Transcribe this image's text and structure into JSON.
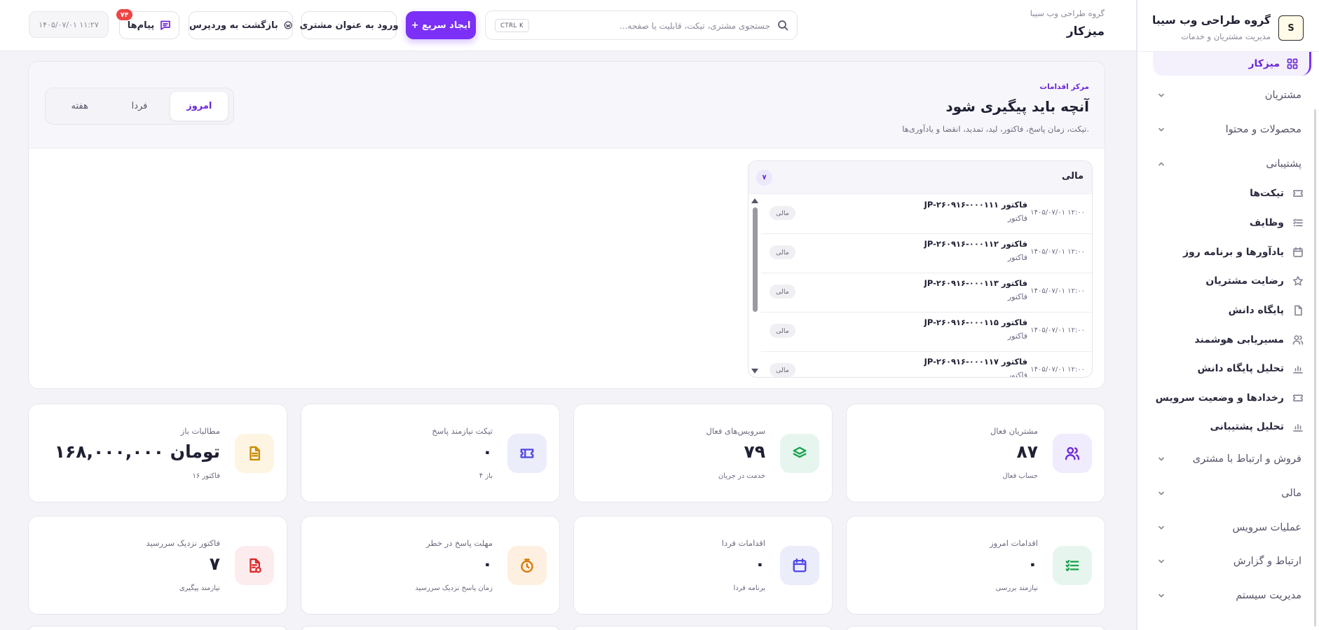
{
  "brand": {
    "logo_text": "S",
    "title": "گروه طراحی وب سیبا",
    "subtitle": "مدیریت مشتریان و خدمات"
  },
  "sidebar": {
    "active": {
      "label": "میزکار",
      "icon": "dashboard-icon"
    },
    "groups": [
      {
        "label": "مشتریان"
      },
      {
        "label": "محصولات و محتوا"
      },
      {
        "label": "پشتیبانی"
      },
      {
        "label": "فروش و ارتباط با مشتری"
      },
      {
        "label": "مالی"
      },
      {
        "label": "عملیات سرویس"
      },
      {
        "label": "ارتباط و گزارش"
      },
      {
        "label": "مدیریت سیستم"
      }
    ],
    "support_items": [
      {
        "label": "تیکت‌ها",
        "icon": "ticket-icon"
      },
      {
        "label": "وظایف",
        "icon": "task-list-icon"
      },
      {
        "label": "یادآورها و برنامه روز",
        "icon": "calendar-icon"
      },
      {
        "label": "رضایت مشتریان",
        "icon": "star-icon"
      },
      {
        "label": "پایگاه دانش",
        "icon": "document-icon"
      },
      {
        "label": "مسیریابی هوشمند",
        "icon": "users-icon"
      },
      {
        "label": "تحلیل پایگاه دانش",
        "icon": "bar-chart-icon"
      },
      {
        "label": "رخدادها و وضعیت سرویس",
        "icon": "ticket-icon"
      },
      {
        "label": "تحلیل پشتیبانی",
        "icon": "bar-chart-icon"
      }
    ]
  },
  "header": {
    "breadcrumb": "گروه طراحی وب سیبا",
    "title": "میزکار",
    "search_placeholder": "جستجوی مشتری، تیکت، قابلیت یا صفحه...",
    "search_shortcut": "CTRL K",
    "quick_create": "+ ایجاد سریع",
    "login_as_customer": "ورود به عنوان مشتری",
    "back_to_wordpress": "بازگشت به وردپرس",
    "messages": "پیام‌ها",
    "messages_count": "۷۴",
    "datetime": "۱۴۰۵/۰۷/۰۱ ۱۱:۲۷"
  },
  "action_center": {
    "kicker": "مرکز اقدامات",
    "title": "آنچه باید پیگیری شود",
    "description": "تیکت، زمان پاسخ، فاکتور، لید، تمدید، انقضا و یادآوری‌ها.",
    "tabs": [
      "امروز",
      "فردا",
      "هفته"
    ],
    "active_tab": "امروز",
    "finance_panel": {
      "title": "مالی",
      "count": "۷",
      "rows": [
        {
          "title": "فاکتور JP-۲۶۰۹۱۶-۰۰۰۱۱۱",
          "type": "فاکتور",
          "time": "۱۴۰۵/۰۷/۰۱ ۱۲:۰۰",
          "tag": "مالی"
        },
        {
          "title": "فاکتور JP-۲۶۰۹۱۶-۰۰۰۱۱۲",
          "type": "فاکتور",
          "time": "۱۴۰۵/۰۷/۰۱ ۱۲:۰۰",
          "tag": "مالی"
        },
        {
          "title": "فاکتور JP-۲۶۰۹۱۶-۰۰۰۱۱۳",
          "type": "فاکتور",
          "time": "۱۴۰۵/۰۷/۰۱ ۱۲:۰۰",
          "tag": "مالی"
        },
        {
          "title": "فاکتور JP-۲۶۰۹۱۶-۰۰۰۱۱۵",
          "type": "فاکتور",
          "time": "۱۴۰۵/۰۷/۰۱ ۱۲:۰۰",
          "tag": "مالی"
        },
        {
          "title": "فاکتور JP-۲۶۰۹۱۶-۰۰۰۱۱۷",
          "type": "فاکتور",
          "time": "۱۴۰۵/۰۷/۰۱ ۱۲:۰۰",
          "tag": "مالی"
        }
      ]
    }
  },
  "stats": [
    {
      "label": "مشتریان فعال",
      "value": "۸۷",
      "sub": "حساب فعال",
      "icon": "users-icon",
      "bg": "#f0ebfd",
      "fg": "#6d28d9"
    },
    {
      "label": "سرویس‌های فعال",
      "value": "۷۹",
      "sub": "خدمت در جریان",
      "icon": "layers-icon",
      "bg": "#e6f6ee",
      "fg": "#16a34a"
    },
    {
      "label": "تیکت نیازمند پاسخ",
      "value": "۰",
      "sub": "۴ باز",
      "icon": "ticket-icon",
      "bg": "#ecedfb",
      "fg": "#4f46e5"
    },
    {
      "label": "مطالبات باز",
      "value": "۱۶۸,۰۰۰,۰۰۰ تومان",
      "sub": "۱۶ فاکتور",
      "icon": "document-icon",
      "bg": "#fdf5e1",
      "fg": "#ca8a04"
    },
    {
      "label": "اقدامات امروز",
      "value": "۰",
      "sub": "نیازمند بررسی",
      "icon": "checklist-icon",
      "bg": "#e6f6ee",
      "fg": "#16a34a"
    },
    {
      "label": "اقدامات فردا",
      "value": "۰",
      "sub": "برنامه فردا",
      "icon": "calendar-icon",
      "bg": "#ecedfb",
      "fg": "#4f46e5"
    },
    {
      "label": "مهلت پاسخ در خطر",
      "value": "۰",
      "sub": "زمان پاسخ نزدیک سررسید",
      "icon": "clock-icon",
      "bg": "#fdf0e1",
      "fg": "#d97706"
    },
    {
      "label": "فاکتور نزدیک سررسید",
      "value": "۷",
      "sub": "نیازمند پیگیری",
      "icon": "invoice-alert-icon",
      "bg": "#fdecee",
      "fg": "#dc2626"
    }
  ],
  "colors": {
    "accent": "#7b2ff7",
    "badge": "#ef4444",
    "background": "#f3f3f8"
  }
}
